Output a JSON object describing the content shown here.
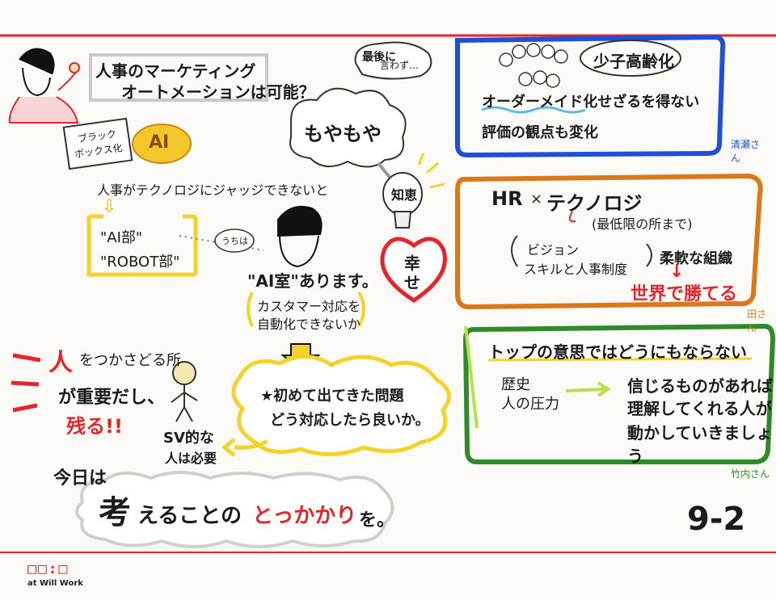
{
  "header": {
    "question_line1": "人事のマーケティング",
    "question_line2": "オートメーションは可能？"
  },
  "left_top": {
    "blackbox_line1": "ブラック",
    "blackbox_line2": "ボックス化",
    "ai_brain": "AI",
    "judge_text": "人事がテクノロジにジャッジできないと",
    "arrow": "⇩",
    "dept_ai": "\"AI部\"",
    "dept_robot": "\"ROBOT部\""
  },
  "center": {
    "finally_bubble_line1": "最後に",
    "finally_bubble_line2": "言わず…",
    "moyamoya": "もやもや",
    "wisdom": "知恵",
    "happiness_line1": "幸",
    "happiness_line2": "せ",
    "uchi_ha": "うちは",
    "ai_room": "\"AI室\"あります。",
    "customer_line1": "カスタマー対応を",
    "customer_line2": "自動化できないか",
    "new_problem_line1": "★初めて出てきた問題",
    "new_problem_line2": "どう対応したら良いか。"
  },
  "left_bottom": {
    "hito_mark": "人",
    "hito_rest": "をつかさどる所",
    "important": "が重要だし、",
    "remain": "残る!!",
    "sv_line1": "SV的な",
    "sv_line2": "人は必要",
    "today": "今日は",
    "cloud_kan": "考",
    "cloud_text1": "えることの",
    "cloud_text2": "とっかかり",
    "cloud_text3": "を。"
  },
  "blue_box": {
    "title": "少子高齢化",
    "line1": "オーダーメイド化せざるを得ない",
    "line2": "評価の観点も変化",
    "speaker": "清瀬さん"
  },
  "orange_box": {
    "title_hr": "HR",
    "title_x": "×",
    "title_tech": "テクノロジ",
    "min": "(最低限の所まで)",
    "vision": "ビジョン",
    "skill": "スキルと人事制度",
    "flexible": "柔軟な組織",
    "arrow": "↓",
    "win": "世界で勝てる",
    "speaker": "田さん"
  },
  "green_box": {
    "title": "トップの意思ではどうにもならない",
    "history_line1": "歴史",
    "history_line2": "人の圧力",
    "arrow": "→",
    "believe_line1": "信じるものがあれば",
    "believe_line2": "理解してくれる人が",
    "believe_line3": "動かしていきましょう",
    "speaker": "竹内さん"
  },
  "page_number": "9-2",
  "footer": {
    "logo_mark": "□□:□",
    "logo_text": "at Will Work"
  },
  "colors": {
    "red": "#e4262c",
    "blue": "#1f4fd8",
    "orange": "#d9791b",
    "green": "#2f8a2a",
    "yellow": "#f3d22a",
    "gray": "#9a9a9a"
  }
}
